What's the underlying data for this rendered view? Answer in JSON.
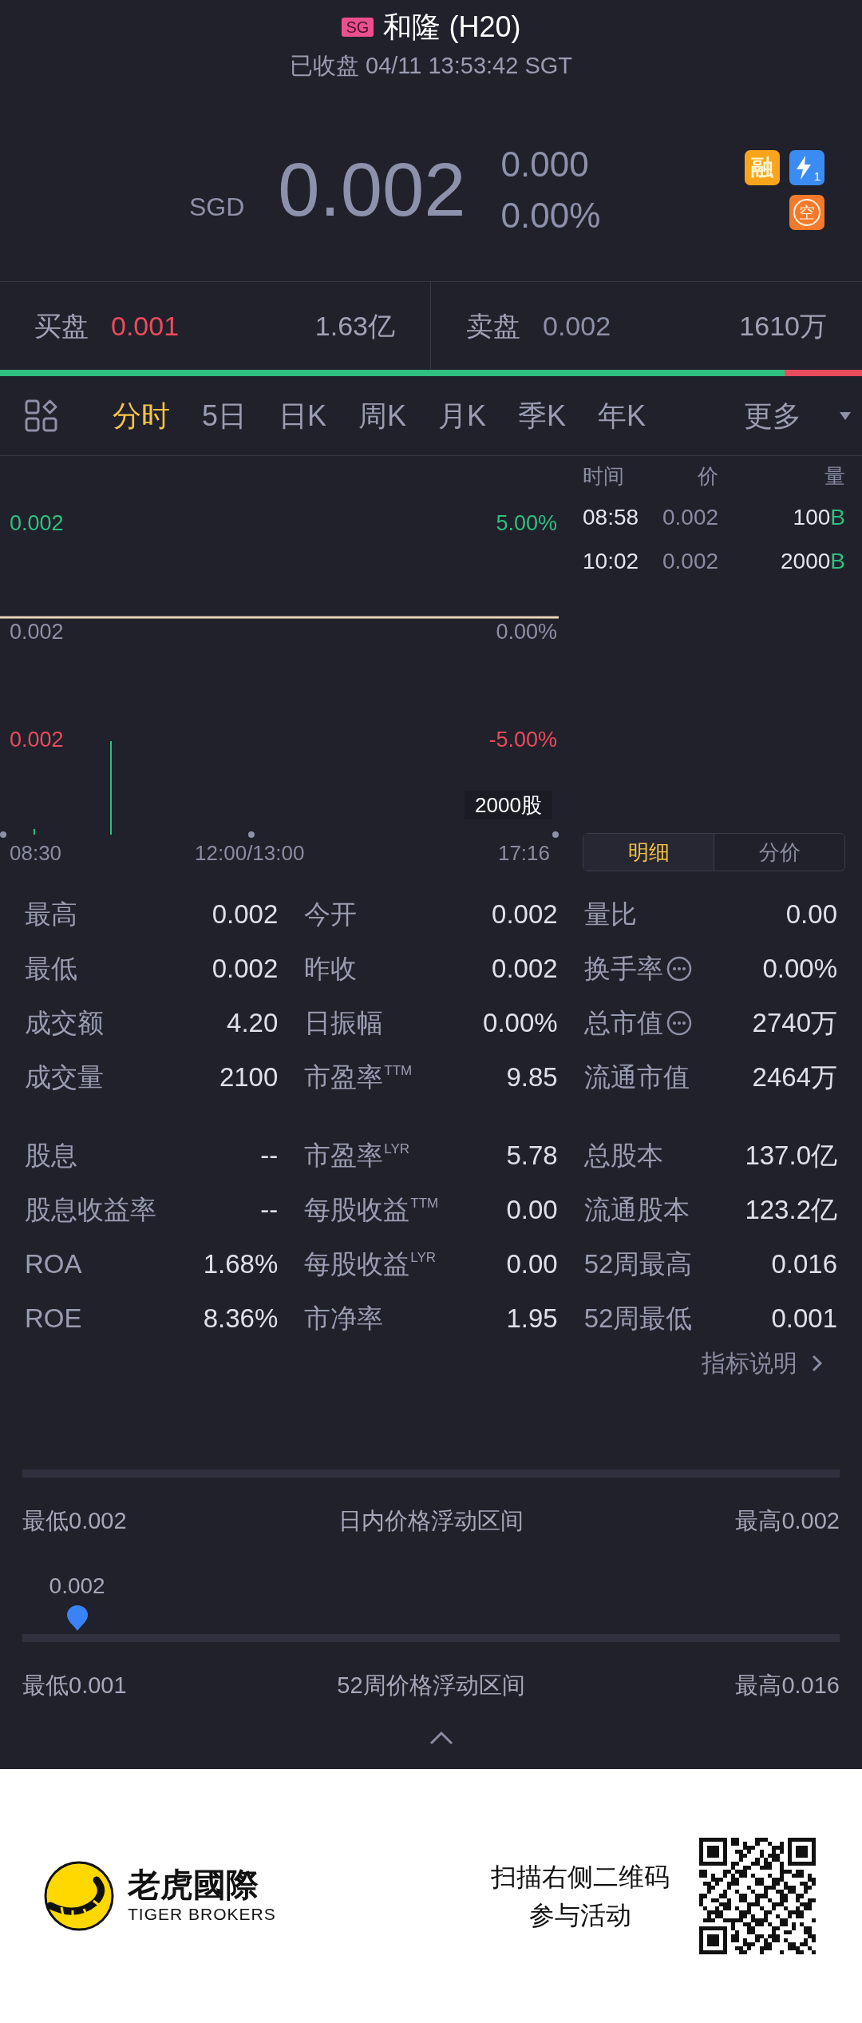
{
  "header": {
    "market": "SG",
    "title": "和隆 (H20)",
    "status": "已收盘 04/11 13:53:42 SGT"
  },
  "quote": {
    "currency": "SGD",
    "price": "0.002",
    "change": "0.000",
    "change_percent": "0.00%",
    "tags": [
      {
        "kind": "plain",
        "label": "融",
        "color": "#f8a51b"
      },
      {
        "kind": "lightning",
        "label": "1",
        "color": "#3b8cf2"
      },
      {
        "kind": "circled",
        "label": "空",
        "color": "#f5792a"
      }
    ]
  },
  "order_book": {
    "sides": [
      {
        "label": "买盘",
        "price": "0.001",
        "color": "#ec4b5c",
        "volume": "1.63亿"
      },
      {
        "label": "卖盘",
        "price": "0.002",
        "color": "#8d90a6",
        "volume": "1610万"
      }
    ],
    "ratio": {
      "level": 0.91
    }
  },
  "period_tabs": {
    "items": [
      {
        "label": "分时",
        "selected": true
      },
      {
        "label": "5日",
        "selected": false
      },
      {
        "label": "日K",
        "selected": false
      },
      {
        "label": "周K",
        "selected": false
      },
      {
        "label": "月K",
        "selected": false
      },
      {
        "label": "季K",
        "selected": false
      },
      {
        "label": "年K",
        "selected": false
      }
    ],
    "more": "更多"
  },
  "chart": {
    "price_labels": [
      {
        "text": "0.002",
        "color": "#2fbf7f"
      },
      {
        "text": "0.002",
        "color": "#8d90a6"
      },
      {
        "text": "0.002",
        "color": "#ec4b5c"
      }
    ],
    "percent_labels": [
      {
        "text": "5.00%",
        "color": "#2fbf7f"
      },
      {
        "text": "0.00%",
        "color": "#8d90a6"
      },
      {
        "text": "-5.00%",
        "color": "#ec4b5c"
      }
    ],
    "volume_label": "2000股",
    "time_labels": [
      "08:30",
      "12:00/13:00",
      "17:16"
    ]
  },
  "trades": {
    "columns": [
      "时间",
      "价",
      "量"
    ],
    "rows": [
      {
        "time": "08:58",
        "price": "0.002",
        "volume": "100",
        "side": "B"
      },
      {
        "time": "10:02",
        "price": "0.002",
        "volume": "2000",
        "side": "B"
      }
    ],
    "views": [
      {
        "label": "明细",
        "selected": true
      },
      {
        "label": "分价",
        "selected": false
      }
    ]
  },
  "stat_groups": [
    [
      [
        {
          "label": "最高",
          "value": "0.002"
        },
        {
          "label": "今开",
          "value": "0.002"
        },
        {
          "label": "量比",
          "value": "0.00"
        }
      ],
      [
        {
          "label": "最低",
          "value": "0.002"
        },
        {
          "label": "昨收",
          "value": "0.002"
        },
        {
          "label": "换手率",
          "value": "0.00%",
          "info": true
        }
      ],
      [
        {
          "label": "成交额",
          "value": "4.20"
        },
        {
          "label": "日振幅",
          "value": "0.00%"
        },
        {
          "label": "总市值",
          "value": "2740万",
          "info": true
        }
      ],
      [
        {
          "label": "成交量",
          "value": "2100"
        },
        {
          "label": "市盈率$^{TTM}$",
          "value": "9.85"
        },
        {
          "label": "流通市值",
          "value": "2464万"
        }
      ]
    ],
    [
      [
        {
          "label": "股息",
          "value": "--"
        },
        {
          "label": "市盈率$^{LYR}$",
          "value": "5.78"
        },
        {
          "label": "总股本",
          "value": "137.0亿"
        }
      ],
      [
        {
          "label": "股息收益率",
          "value": "--"
        },
        {
          "label": "每股收益$^{TTM}$",
          "value": "0.00"
        },
        {
          "label": "流通股本",
          "value": "123.2亿"
        }
      ],
      [
        {
          "label": "ROA",
          "value": "1.68%"
        },
        {
          "label": "每股收益$^{LYR}$",
          "value": "0.00"
        },
        {
          "label": "52周最高",
          "value": "0.016"
        }
      ],
      [
        {
          "label": "ROE",
          "value": "8.36%"
        },
        {
          "label": "市净率",
          "value": "1.95"
        },
        {
          "label": "52周最低",
          "value": "0.001"
        }
      ]
    ]
  ],
  "indicator_link": "指标说明",
  "ranges": [
    {
      "low": "最低0.002",
      "title": "日内价格浮动区间",
      "high": "最高0.002"
    },
    {
      "low": "最低0.001",
      "title": "52周价格浮动区间",
      "high": "最高0.016",
      "marker": {
        "label": "0.002",
        "level": 0.067
      }
    }
  ],
  "footer": {
    "brand": "老虎國際",
    "brand_en": "TIGER BROKERS",
    "promo": [
      "扫描右侧二维码",
      "参与活动"
    ]
  }
}
